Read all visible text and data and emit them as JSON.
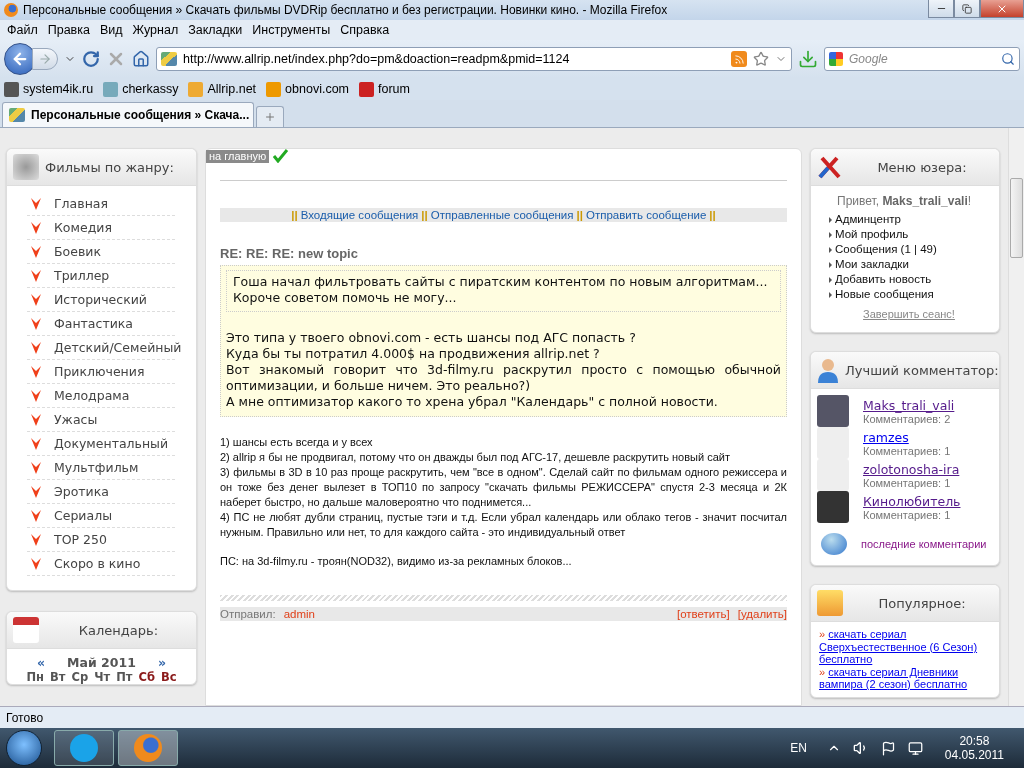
{
  "window": {
    "title": "Персональные сообщения » Скачать фильмы DVDRip бесплатно и без регистрации. Новинки кино. - Mozilla Firefox"
  },
  "menu": [
    "Файл",
    "Правка",
    "Вид",
    "Журнал",
    "Закладки",
    "Инструменты",
    "Справка"
  ],
  "toolbar": {
    "url": "http://www.allrip.net/index.php?do=pm&doaction=readpm&pmid=1124",
    "search_placeholder": "Google"
  },
  "bookmarks": [
    "system4ik.ru",
    "cherkassy",
    "Allrip.net",
    "obnovi.com",
    "forum"
  ],
  "tabs": [
    {
      "label": "Персональные сообщения » Скача...",
      "selected": true
    }
  ],
  "genres": {
    "title": "Фильмы по жанру:",
    "items": [
      "Главная",
      "Комедия",
      "Боевик",
      "Триллер",
      "Исторический",
      "Фантастика",
      "Детский/Семейный",
      "Приключения",
      "Мелодрама",
      "Ужасы",
      "Документальный",
      "Мультфильм",
      "Эротика",
      "Сериалы",
      "TOP 250",
      "Скоро в кино"
    ]
  },
  "calendar": {
    "title": "Календарь:",
    "prev": "«",
    "month": "Май 2011",
    "next": "»",
    "weekdays": [
      {
        "label": "Пн",
        "weekend": false
      },
      {
        "label": "Вт",
        "weekend": false
      },
      {
        "label": "Ср",
        "weekend": false
      },
      {
        "label": "Чт",
        "weekend": false
      },
      {
        "label": "Пт",
        "weekend": false
      },
      {
        "label": "Сб",
        "weekend": true
      },
      {
        "label": "Вс",
        "weekend": true
      }
    ]
  },
  "home_link": "на главную",
  "pm_nav": {
    "separator": "||",
    "links": [
      "Входящие сообщения",
      "Отправленные сообщения",
      "Отправить сообщение"
    ]
  },
  "message": {
    "subject": "RE: RE: RE: new topic",
    "quote": [
      "Гоша начал фильтровать сайты с пиратским контентом по новым алгоритмам...",
      "Короче советом помочь не могу..."
    ],
    "quoted_body": [
      "Это типа у твоего obnovi.com - есть шансы под АГС попасть ?",
      "Куда бы ты потратил 4.000$ на продвижения allrip.net ?",
      "Вот знакомый говорит что 3d-filmy.ru раскрутил просто с помощью обычной оптимизации, и больше ничем. Это реально?)",
      "А мне оптимизатор какого то хрена убрал \"Календарь\" с полной новости."
    ],
    "reply": [
      "1) шансы есть всегда и у всех",
      "2) allrip я бы не продвигал, потому что он дважды был под АГС-17, дешевле раскрутить новый сайт",
      "3) фильмы в 3D в 10 раз проще раскрутить, чем \"все в одном\". Сделай сайт по фильмам одного режиссера и он тоже без денег вылезет в ТОП10 по запросу \"скачать фильмы РЕЖИССЕРА\" спустя 2-3 месяца и 2К наберет быстро, но дальше маловероятно что поднимется...",
      "4) ПС не любят дубли страниц, пустые тэги и т.д. Если убрал календарь или облако тегов - значит посчитал нужным. Правильно или нет, то для каждого сайта - это индивидуальный ответ"
    ],
    "ps": "ПС: на 3d-filmy.ru - троян(NOD32), видимо из-за рекламных блоков...",
    "sender_label": "Отправил:",
    "sender": "admin",
    "actions": [
      "[ответить]",
      "[удалить]"
    ]
  },
  "user_menu": {
    "title": "Меню юзера:",
    "greeting": "Привет,",
    "username": "Maks_trali_vali",
    "exclamation": "!",
    "items": [
      "Админцентр",
      "Мой профиль",
      "Сообщения (1 | 49)",
      "Мои закладки",
      "Добавить новость",
      "Новые сообщения"
    ],
    "logout": "Завершить сеанс!"
  },
  "top_commenters": {
    "title": "Лучший комментатор:",
    "people": [
      {
        "name": "Maks_trali_vali",
        "count": "Комментариев: 2",
        "visited": true
      },
      {
        "name": "ramzes",
        "count": "Комментариев: 1",
        "visited": false
      },
      {
        "name": "zolotonosha-ira",
        "count": "Комментариев: 1",
        "visited": true
      },
      {
        "name": "Кинолюбитель",
        "count": "Комментариев: 1",
        "visited": true
      }
    ],
    "latest_link": "последние комментарии"
  },
  "popular": {
    "title": "Популярное:",
    "bullet": "»",
    "items": [
      "скачать сериал Сверхъестественное (6 Сезон) бесплатно",
      "скачать сериал Дневники вампира (2 сезон) бесплатно"
    ]
  },
  "status_bar": "Готово",
  "taskbar": {
    "language": "EN",
    "time": "20:58",
    "date": "04.05.2011"
  }
}
